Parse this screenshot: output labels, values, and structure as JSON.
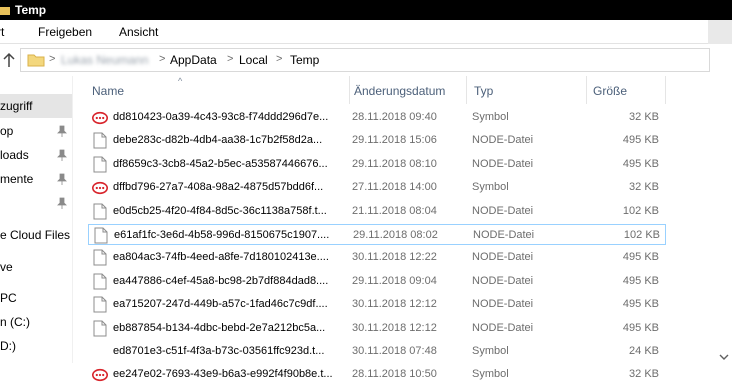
{
  "window": {
    "title": "Temp"
  },
  "ribbon": {
    "tabs": [
      "rt",
      "Freigeben",
      "Ansicht"
    ]
  },
  "address": {
    "crumbs": [
      "Lukas Neumann",
      "AppData",
      "Local",
      "Temp"
    ],
    "separator": ">"
  },
  "nav": {
    "items": [
      {
        "label": "zugriff",
        "pinned": false,
        "selected": true
      },
      {
        "label": "op",
        "pinned": true,
        "selected": false
      },
      {
        "label": "loads",
        "pinned": true,
        "selected": false
      },
      {
        "label": "mente",
        "pinned": true,
        "selected": false
      },
      {
        "label": "",
        "pinned": true,
        "selected": false
      },
      {
        "label": "e Cloud Files",
        "pinned": false,
        "selected": false
      },
      {
        "label": "ve",
        "pinned": false,
        "selected": false
      },
      {
        "label": "PC",
        "pinned": false,
        "selected": false
      },
      {
        "label": "n (C:)",
        "pinned": false,
        "selected": false
      },
      {
        "label": "D:)",
        "pinned": false,
        "selected": false
      }
    ]
  },
  "columns": {
    "name": "Name",
    "date": "Änderungsdatum",
    "type": "Typ",
    "size": "Größe"
  },
  "files": [
    {
      "name": "dd810423-0a39-4c43-93c8-f74ddd296d7e...",
      "date": "28.11.2018 09:40",
      "type": "Symbol",
      "size": "32 KB",
      "icon": "symbol-red-icon",
      "selected": false
    },
    {
      "name": "debe283c-d82b-4db4-aa38-1c7b2f58d2a...",
      "date": "29.11.2018 15:06",
      "type": "NODE-Datei",
      "size": "495 KB",
      "icon": "file-icon",
      "selected": false
    },
    {
      "name": "df8659c3-3cb8-45a2-b5ec-a53587446676...",
      "date": "29.11.2018 08:10",
      "type": "NODE-Datei",
      "size": "495 KB",
      "icon": "file-icon",
      "selected": false
    },
    {
      "name": "dffbd796-27a7-408a-98a2-4875d57bdd6f...",
      "date": "27.11.2018 14:00",
      "type": "Symbol",
      "size": "32 KB",
      "icon": "symbol-red-icon",
      "selected": false
    },
    {
      "name": "e0d5cb25-4f20-4f84-8d5c-36c1138a758f.t...",
      "date": "21.11.2018 08:04",
      "type": "NODE-Datei",
      "size": "102 KB",
      "icon": "file-icon",
      "selected": false
    },
    {
      "name": "e61af1fc-3e6d-4b58-996d-8150675c1907....",
      "date": "29.11.2018 08:02",
      "type": "NODE-Datei",
      "size": "102 KB",
      "icon": "file-icon",
      "selected": true
    },
    {
      "name": "ea804ac3-74fb-4eed-a8fe-7d180102413e....",
      "date": "30.11.2018 12:22",
      "type": "NODE-Datei",
      "size": "495 KB",
      "icon": "file-icon",
      "selected": false
    },
    {
      "name": "ea447886-c4ef-45a8-bc98-2b7df884dad8....",
      "date": "29.11.2018 09:04",
      "type": "NODE-Datei",
      "size": "495 KB",
      "icon": "file-icon",
      "selected": false
    },
    {
      "name": "ea715207-247d-449b-a57c-1fad46c7c9df....",
      "date": "30.11.2018 12:12",
      "type": "NODE-Datei",
      "size": "495 KB",
      "icon": "file-icon",
      "selected": false
    },
    {
      "name": "eb887854-b134-4dbc-bebd-2e7a212bc5a...",
      "date": "30.11.2018 12:12",
      "type": "NODE-Datei",
      "size": "495 KB",
      "icon": "file-icon",
      "selected": false
    },
    {
      "name": "ed8701e3-c51f-4f3a-b73c-03561ffc923d.t...",
      "date": "30.11.2018 07:48",
      "type": "Symbol",
      "size": "24 KB",
      "icon": "blank-icon",
      "selected": false
    },
    {
      "name": "ee247e02-7693-43e9-b6a3-e992f4f90b8e.t...",
      "date": "28.11.2018 10:50",
      "type": "Symbol",
      "size": "32 KB",
      "icon": "symbol-red-icon",
      "selected": false
    }
  ]
}
